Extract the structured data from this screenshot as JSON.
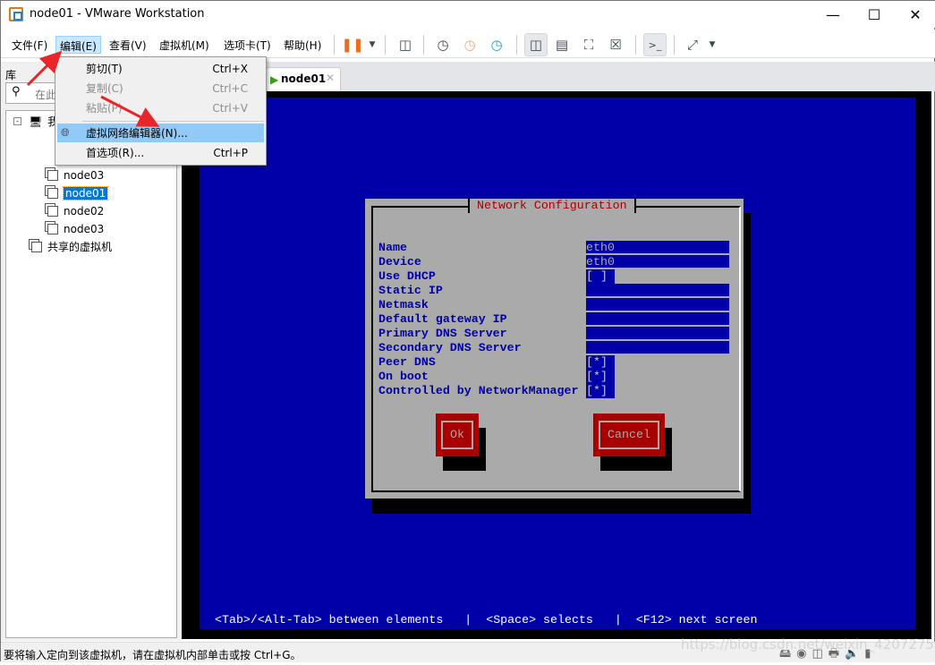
{
  "window": {
    "title": "node01 - VMware Workstation",
    "controls": [
      "minimize",
      "maximize",
      "close"
    ]
  },
  "menubar": {
    "items": [
      "文件(F)",
      "编辑(E)",
      "查看(V)",
      "虚拟机(M)",
      "选项卡(T)",
      "帮助(H)"
    ],
    "active": "编辑(E)"
  },
  "toolbar": {
    "icons": [
      "pause-icon",
      "dropdown-icon",
      "send-ctrl-alt-del-icon",
      "snapshot-take-icon",
      "snapshot-revert-icon",
      "snapshot-manager-icon",
      "show-library-icon",
      "thumbnail-bar-icon",
      "fullscreen-icon",
      "unity-icon",
      "console-view-icon",
      "stretch-icon",
      "dropdown-icon"
    ]
  },
  "library": {
    "title": "库",
    "search_placeholder": "在此",
    "tree": [
      "我",
      "node03",
      "node01",
      "node02",
      "node03",
      "共享的虚拟机"
    ],
    "selected": "node01"
  },
  "tab": {
    "label": "node01"
  },
  "edit_menu": {
    "items": [
      {
        "label": "剪切(T)",
        "shortcut": "Ctrl+X",
        "enabled": true
      },
      {
        "label": "复制(C)",
        "shortcut": "Ctrl+C",
        "enabled": false
      },
      {
        "label": "粘贴(P)",
        "shortcut": "Ctrl+V",
        "enabled": false
      },
      {
        "label": "虚拟网络编辑器(N)...",
        "shortcut": "",
        "enabled": true,
        "highlighted": true
      },
      {
        "label": "首选项(R)...",
        "shortcut": "Ctrl+P",
        "enabled": true
      }
    ]
  },
  "console": {
    "dialog_title": "Network Configuration",
    "fields": [
      {
        "label": "Name",
        "value": "eth0",
        "type": "text"
      },
      {
        "label": "Device",
        "value": "eth0",
        "type": "text"
      },
      {
        "label": "Use DHCP",
        "value": "[ ]",
        "type": "check"
      },
      {
        "label": "Static IP",
        "value": "",
        "type": "text"
      },
      {
        "label": "Netmask",
        "value": "",
        "type": "text"
      },
      {
        "label": "Default gateway IP",
        "value": "",
        "type": "text"
      },
      {
        "label": "Primary DNS Server",
        "value": "",
        "type": "text"
      },
      {
        "label": "Secondary DNS Server",
        "value": "",
        "type": "text"
      },
      {
        "label": "Peer DNS",
        "value": "[*]",
        "type": "check"
      },
      {
        "label": "On boot",
        "value": "[*]",
        "type": "check"
      },
      {
        "label": "Controlled by NetworkManager",
        "value": "[*]",
        "type": "check"
      }
    ],
    "ok": "Ok",
    "cancel": "Cancel",
    "help": "<Tab>/<Alt-Tab> between elements   |  <Space> selects   |  <F12> next screen"
  },
  "status": {
    "text": "要将输入定向到该虚拟机，请在虚拟机内部单击或按 Ctrl+G。"
  },
  "watermark": "https://blog.csdn.net/weixin_42072754",
  "colors": {
    "console_blue": "#0000a8",
    "dialog_gray": "#aaaaaa",
    "button_red": "#a80000",
    "title_red": "#a80000",
    "menu_highlight": "#91c9f7",
    "selection": "#0078d7"
  }
}
